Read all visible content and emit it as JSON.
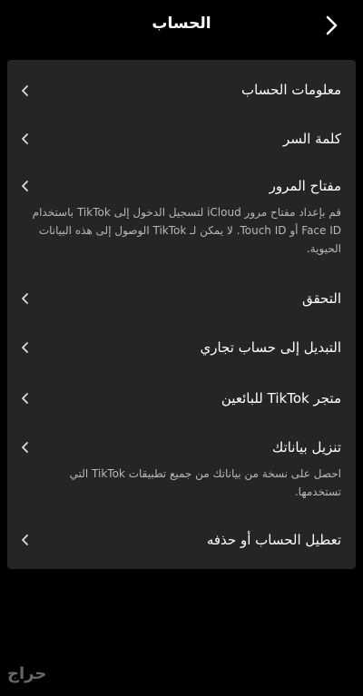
{
  "header": {
    "title": "الحساب"
  },
  "items": [
    {
      "label": "معلومات الحساب"
    },
    {
      "label": "كلمة السر"
    },
    {
      "label": "مفتاح المرور",
      "description": "قم بإعداد مفتاح مرور iCloud لتسجيل الدخول إلى TikTok باستخدام Face ID أو Touch ID. لا يمكن لـ TikTok الوصول إلى هذه البيانات الحيوية."
    },
    {
      "label": "التحقق"
    },
    {
      "label": "التبديل إلى حساب تجاري"
    },
    {
      "label": "متجر TikTok للبائعين"
    },
    {
      "label": "تنزيل بياناتك",
      "description": "احصل على نسخة من بياناتك من جميع تطبيقات TikTok التي تستخدمها."
    },
    {
      "label": "تعطيل الحساب أو حذفه"
    }
  ],
  "watermark": "حراج"
}
